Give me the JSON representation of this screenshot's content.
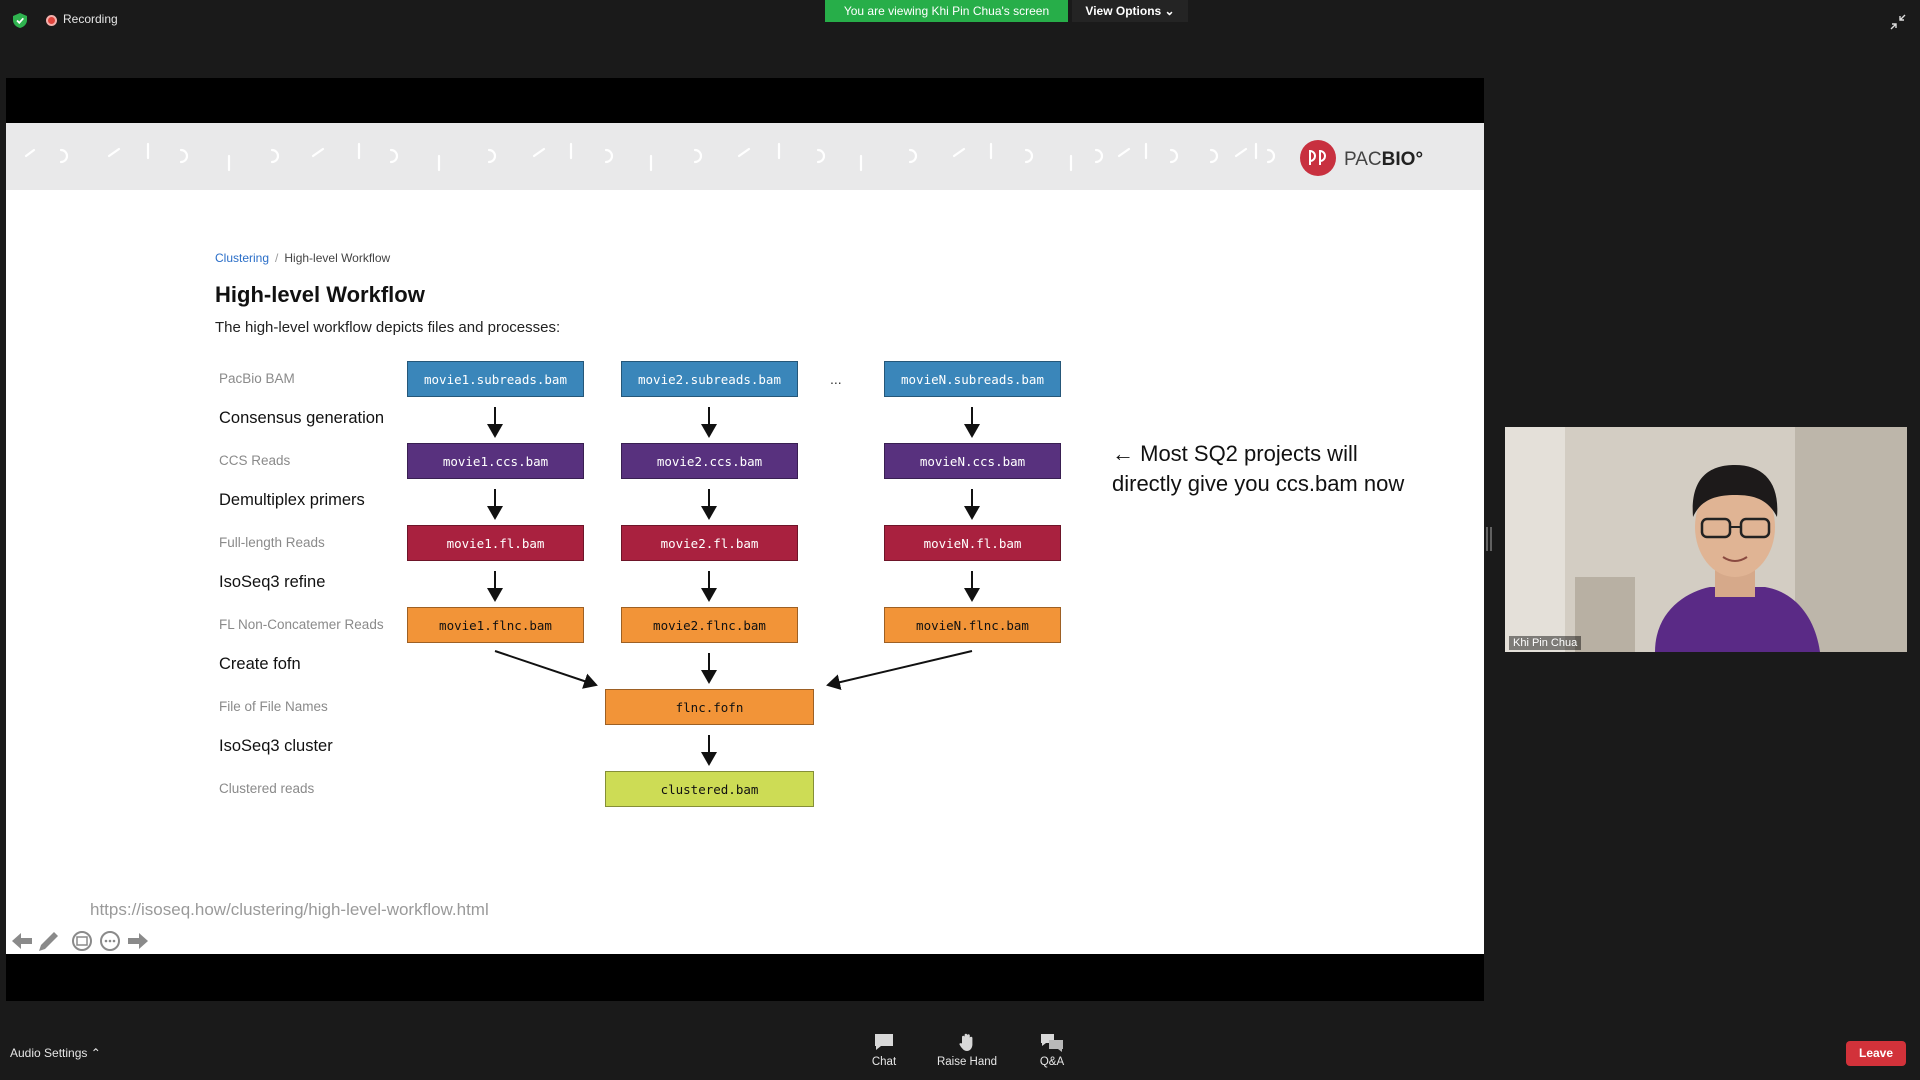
{
  "top_bar": {
    "recording_label": "Recording",
    "viewing_banner": "You are viewing Khi Pin Chua's screen",
    "view_options_label": "View Options ⌄"
  },
  "slide": {
    "logo_text": "PACBIO°",
    "breadcrumb": {
      "link": "Clustering",
      "separator": "/",
      "current": "High-level Workflow"
    },
    "title": "High-level Workflow",
    "subtitle": "The high-level workflow depicts files and processes:",
    "row_labels": {
      "pacbio_bam": "PacBio BAM",
      "consensus": "Consensus generation",
      "ccs_reads": "CCS Reads",
      "demultiplex": "Demultiplex primers",
      "fl_reads": "Full-length Reads",
      "refine": "IsoSeq3 refine",
      "flnc_reads": "FL Non-Concatemer Reads",
      "create_fofn": "Create fofn",
      "fofn": "File of File Names",
      "cluster": "IsoSeq3 cluster",
      "clustered_reads": "Clustered reads"
    },
    "boxes": {
      "movie1_subreads": "movie1.subreads.bam",
      "movie2_subreads": "movie2.subreads.bam",
      "movieN_subreads": "movieN.subreads.bam",
      "movie1_ccs": "movie1.ccs.bam",
      "movie2_ccs": "movie2.ccs.bam",
      "movieN_ccs": "movieN.ccs.bam",
      "movie1_fl": "movie1.fl.bam",
      "movie2_fl": "movie2.fl.bam",
      "movieN_fl": "movieN.fl.bam",
      "movie1_flnc": "movie1.flnc.bam",
      "movie2_flnc": "movie2.flnc.bam",
      "movieN_flnc": "movieN.flnc.bam",
      "fofn": "flnc.fofn",
      "clustered": "clustered.bam"
    },
    "ellipsis": "...",
    "note_line1": "← Most SQ2 projects will",
    "note_line2": "directly give you ccs.bam now",
    "url": "https://isoseq.how/clustering/high-level-workflow.html"
  },
  "video": {
    "participant_name": "Khi Pin Chua"
  },
  "bottom_bar": {
    "audio_settings_label": "Audio Settings ⌃",
    "chat_label": "Chat",
    "raise_hand_label": "Raise Hand",
    "qa_label": "Q&A",
    "leave_label": "Leave"
  },
  "colors": {
    "banner_green": "#27ae49",
    "leave_red": "#d2323a",
    "box_blue": "#3a86ba",
    "box_purple": "#58317e",
    "box_red": "#a9213f",
    "box_orange": "#f29438",
    "box_lime": "#cddc55",
    "pacbio_red": "#c8303f"
  }
}
